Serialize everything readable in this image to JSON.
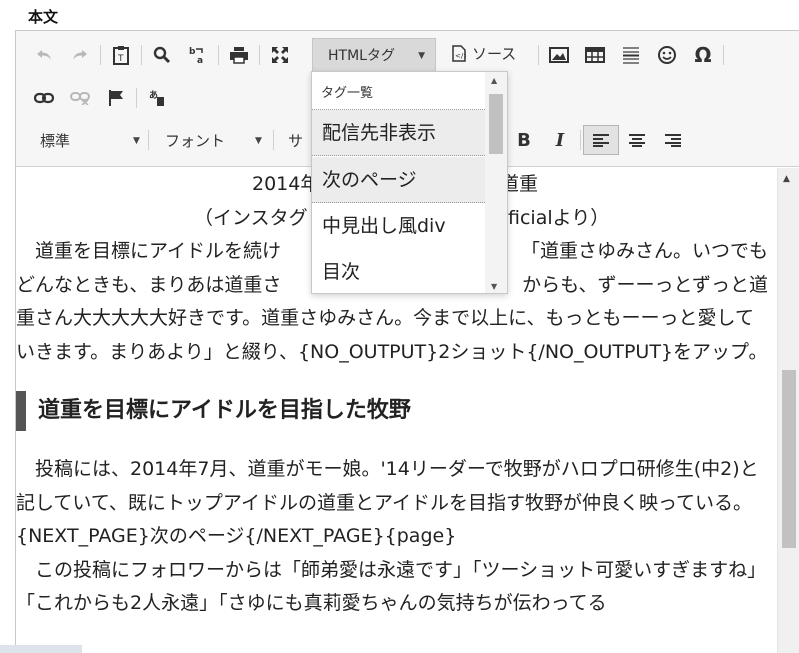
{
  "section_label": "本文",
  "toolbar": {
    "html_tag_label": "HTMLタグ",
    "source_label": "ソース",
    "format_label": "標準",
    "font_label": "フォント",
    "size_label_partial": "サ"
  },
  "dropdown": {
    "title": "タグ一覧",
    "items": [
      "配信先非表示",
      "次のページ",
      "中見出し風div",
      "目次"
    ]
  },
  "content": {
    "caption_line1_left": "2014年",
    "caption_line1_right": "道重",
    "caption_line2_left": "（インスタグ",
    "caption_line2_right": "ficialより）",
    "para1_line1_left": "　道重を目標にアイドルを続け",
    "para1_line1_right": "「道重さゆみさん。いつでも",
    "para1_line2_left": "どんなときも、まりあは道重さ",
    "para1_line2_right": "からも、ずーーっとずっと道",
    "para1_rest": "重さん大大大大大好きです。道重さゆみさん。今まで以上に、もっともーーっと愛していきます。まりあより」と綴り、{NO_OUTPUT}2ショット{/NO_OUTPUT}をアップ。",
    "heading": "道重を目標にアイドルを目指した牧野",
    "para2": "　投稿には、2014年7月、道重がモー娘。'14リーダーで牧野がハロプロ研修生(中2)と記していて、既にトップアイドルの道重とアイドルを目指す牧野が仲良く映っている。{NEXT_PAGE}次のページ{/NEXT_PAGE}{page}",
    "para3": "　この投稿にフォロワーからは「師弟愛は永遠です」「ツーショット可愛いすぎますね」「これからも2人永遠」「さゆにも真莉愛ちゃんの気持ちが伝わってる"
  }
}
